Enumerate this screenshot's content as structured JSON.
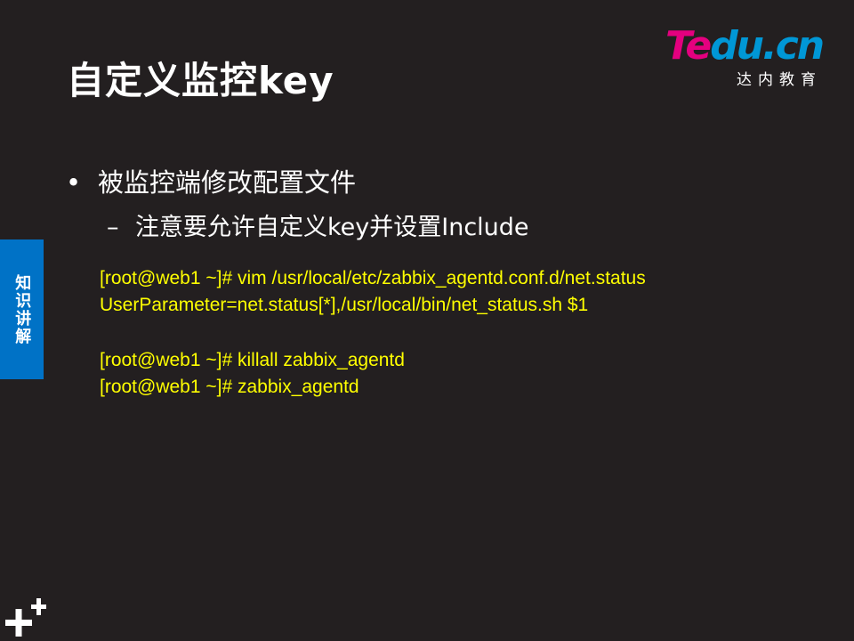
{
  "slide": {
    "title": "自定义监控key",
    "logo": {
      "brand_part1": "Te",
      "brand_part2": "du.cn",
      "subtitle": "达内教育",
      "colors": {
        "te": "#e4007f",
        "du": "#0097d6"
      }
    },
    "side_tab": {
      "label": "知识讲解",
      "color": "#0072c6"
    },
    "bullets": [
      {
        "marker": "•",
        "text": "被监控端修改配置文件"
      },
      {
        "marker": "–",
        "text": "注意要允许自定义key并设置Include"
      }
    ],
    "code_blocks": [
      {
        "lines": [
          "[root@web1 ~]# vim /usr/local/etc/zabbix_agentd.conf.d/net.status",
          "UserParameter=net.status[*],/usr/local/bin/net_status.sh $1"
        ]
      },
      {
        "lines": [
          "[root@web1 ~]# killall zabbix_agentd",
          "[root@web1 ~]# zabbix_agentd"
        ]
      }
    ],
    "code_color": "#ffff00",
    "background": "#231f20",
    "corner_icon": "plus-plus-icon"
  }
}
